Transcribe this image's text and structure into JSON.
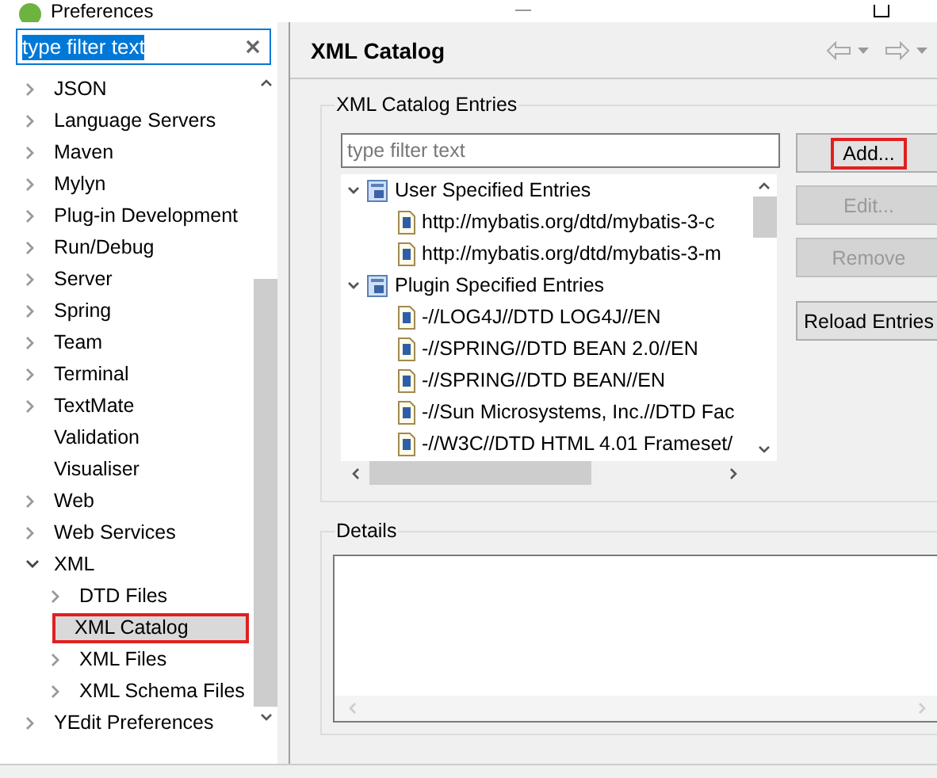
{
  "window": {
    "title": "Preferences"
  },
  "sidebar": {
    "filter": {
      "value": "type filter text"
    },
    "items": [
      {
        "label": "JSON",
        "expandable": true,
        "expanded": false,
        "selected": false
      },
      {
        "label": "Language Servers",
        "expandable": true,
        "expanded": false,
        "selected": false
      },
      {
        "label": "Maven",
        "expandable": true,
        "expanded": false,
        "selected": false
      },
      {
        "label": "Mylyn",
        "expandable": true,
        "expanded": false,
        "selected": false
      },
      {
        "label": "Plug-in Development",
        "expandable": true,
        "expanded": false,
        "selected": false
      },
      {
        "label": "Run/Debug",
        "expandable": true,
        "expanded": false,
        "selected": false
      },
      {
        "label": "Server",
        "expandable": true,
        "expanded": false,
        "selected": false
      },
      {
        "label": "Spring",
        "expandable": true,
        "expanded": false,
        "selected": false
      },
      {
        "label": "Team",
        "expandable": true,
        "expanded": false,
        "selected": false
      },
      {
        "label": "Terminal",
        "expandable": true,
        "expanded": false,
        "selected": false
      },
      {
        "label": "TextMate",
        "expandable": true,
        "expanded": false,
        "selected": false
      },
      {
        "label": "Validation",
        "expandable": false,
        "selected": false
      },
      {
        "label": "Visualiser",
        "expandable": false,
        "selected": false
      },
      {
        "label": "Web",
        "expandable": true,
        "expanded": false,
        "selected": false
      },
      {
        "label": "Web Services",
        "expandable": true,
        "expanded": false,
        "selected": false
      },
      {
        "label": "XML",
        "expandable": true,
        "expanded": true,
        "selected": false,
        "children": [
          {
            "label": "DTD Files",
            "expandable": true,
            "expanded": false,
            "selected": false
          },
          {
            "label": "XML Catalog",
            "expandable": false,
            "selected": true,
            "annotated": true
          },
          {
            "label": "XML Files",
            "expandable": true,
            "expanded": false,
            "selected": false
          },
          {
            "label": "XML Schema Files",
            "expandable": true,
            "expanded": false,
            "selected": false
          }
        ]
      },
      {
        "label": "YEdit Preferences",
        "expandable": true,
        "expanded": false,
        "selected": false
      }
    ]
  },
  "page": {
    "title": "XML Catalog",
    "entries_group": {
      "label": "XML Catalog Entries",
      "filter": {
        "placeholder": "type filter text"
      },
      "tree": [
        {
          "label": "User Specified Entries",
          "expanded": true,
          "children": [
            "http://mybatis.org/dtd/mybatis-3-c",
            "http://mybatis.org/dtd/mybatis-3-m"
          ]
        },
        {
          "label": "Plugin Specified Entries",
          "expanded": true,
          "children": [
            "-//LOG4J//DTD LOG4J//EN",
            "-//SPRING//DTD BEAN 2.0//EN",
            "-//SPRING//DTD BEAN//EN",
            "-//Sun Microsystems, Inc.//DTD Fac",
            "-//W3C//DTD HTML 4.01 Frameset/"
          ]
        }
      ],
      "buttons": [
        {
          "label": "Add...",
          "disabled": false,
          "annotated": true
        },
        {
          "label": "Edit...",
          "disabled": true,
          "annotated": false
        },
        {
          "label": "Remove",
          "disabled": true,
          "annotated": false
        },
        {
          "label": "Reload Entries",
          "disabled": false,
          "annotated": false
        }
      ]
    },
    "details_group": {
      "label": "Details"
    }
  }
}
